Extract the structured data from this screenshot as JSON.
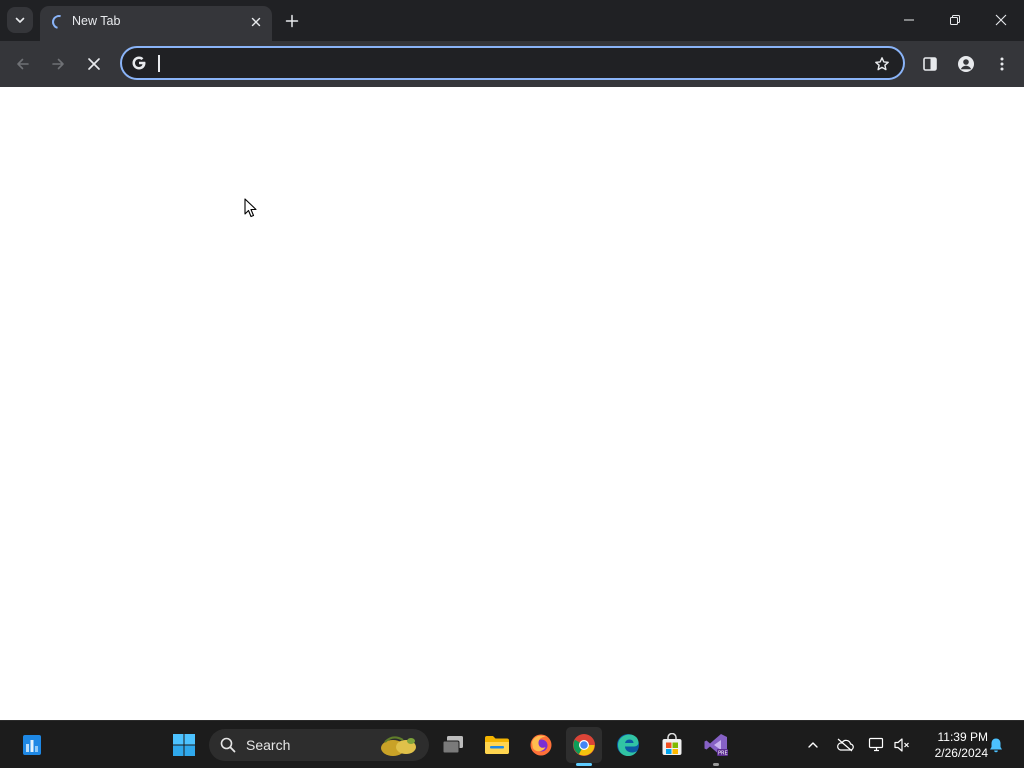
{
  "browser": {
    "tab": {
      "title": "New Tab",
      "loading": true
    },
    "omnibox": {
      "value": "",
      "placeholder": "",
      "focused": true
    },
    "accent_color": "#8ab4f8",
    "icons": {
      "tab_search": "chevron-down-icon",
      "tab_close": "close-icon",
      "new_tab": "plus-icon",
      "back": "arrow-left-icon",
      "forward": "arrow-right-icon",
      "stop": "stop-x-icon",
      "search_engine": "google-g-icon",
      "bookmark": "star-icon",
      "side_panel": "side-panel-icon",
      "profile": "profile-icon",
      "menu": "kebab-menu-icon"
    }
  },
  "window_controls": {
    "icons": [
      "minimize-icon",
      "restore-icon",
      "close-icon"
    ]
  },
  "page": {
    "background": "#ffffff"
  },
  "taskbar": {
    "search_label": "Search",
    "apps": [
      {
        "name": "Widgets",
        "icon": "widgets-icon"
      },
      {
        "name": "Start",
        "icon": "windows-start-icon"
      },
      {
        "name": "Task View",
        "icon": "task-view-icon"
      },
      {
        "name": "File Explorer",
        "icon": "folder-icon"
      },
      {
        "name": "Firefox",
        "icon": "firefox-icon"
      },
      {
        "name": "Google Chrome",
        "icon": "chrome-icon",
        "active": true
      },
      {
        "name": "Microsoft Edge",
        "icon": "edge-icon"
      },
      {
        "name": "Microsoft Store",
        "icon": "store-icon"
      },
      {
        "name": "Visual Studio",
        "icon": "visual-studio-icon",
        "open": true
      }
    ],
    "tray": {
      "time": "11:39 PM",
      "date": "2/26/2024",
      "icons": [
        "chevron-up-icon",
        "cloud-off-icon",
        "network-icon",
        "volume-muted-icon",
        "notification-bell-icon"
      ]
    }
  }
}
